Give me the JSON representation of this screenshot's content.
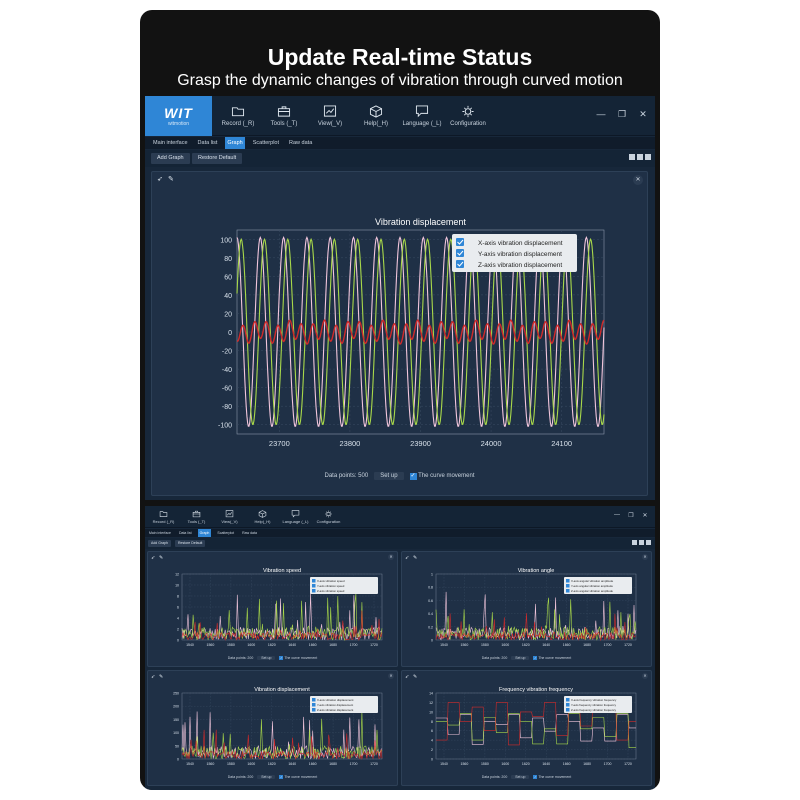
{
  "hero": {
    "title": "Update Real-time Status",
    "subtitle": "Grasp the dynamic changes of vibration through curved motion"
  },
  "app": {
    "logo": "WIT",
    "logo_sub": "witmotion",
    "menu": [
      "Record (_R)",
      "Tools (_T)",
      "View(_V)",
      "Help(_H)",
      "Language (_L)",
      "Configuration"
    ],
    "menu_icons": [
      "folder-icon",
      "toolbox-icon",
      "chart-icon",
      "cube-icon",
      "chat-icon",
      "gear-icon"
    ],
    "window_controls": [
      "—",
      "❐",
      "✕"
    ],
    "tabs": [
      "Main interface",
      "Data list",
      "Graph",
      "Scatterplot",
      "Raw data"
    ],
    "active_tab": 2,
    "toolbar": {
      "add_graph": "Add Graph",
      "restore_default": "Restore Default"
    },
    "accent": "#2f86d6",
    "background": "#17273a",
    "panel_bg": "#1f3046"
  },
  "main_chart": {
    "footer": {
      "points_label": "Data points: 500",
      "set_up": "Set up",
      "curve_movement": "The curve movement"
    }
  },
  "small_charts": {
    "footer": {
      "points_label": "Data points: 200",
      "set_up": "Set up",
      "curve_movement": "The curve movement"
    }
  },
  "chart_data": [
    {
      "type": "line",
      "title": "Vibration displacement",
      "xlim": [
        23640,
        24160
      ],
      "ylim": [
        -110,
        110
      ],
      "xticks": [
        23700,
        23800,
        23900,
        24000,
        24100
      ],
      "yticks": [
        100,
        80,
        60,
        40,
        20,
        0,
        -20,
        -40,
        -60,
        -80,
        -100
      ],
      "legend_position": "top-right",
      "series": [
        {
          "name": "X-axis vibration displacement",
          "color": "#f2c6dc",
          "amplitude": 102,
          "period": 33,
          "phase": 0
        },
        {
          "name": "Y-axis vibration displacement",
          "color": "#a8d84a",
          "amplitude": 100,
          "period": 33,
          "phase": 6
        },
        {
          "name": "Z-axis vibration displacement",
          "color": "#d02a2a",
          "amplitude": 10,
          "period": 16.5,
          "offset": 0
        }
      ]
    },
    {
      "type": "line",
      "title": "Vibration speed",
      "legend_position": "top-right",
      "yticks": [
        12,
        10,
        8,
        6,
        4,
        2,
        0
      ],
      "xticks": [
        "1540",
        "1560",
        "1580",
        "1600",
        "1620",
        "1640",
        "1660",
        "1680",
        "1700",
        "1720"
      ],
      "series": [
        {
          "name": "X-axis vibration speed",
          "color": "#f2c6dc"
        },
        {
          "name": "Y-axis vibration speed",
          "color": "#a8d84a"
        },
        {
          "name": "Z-axis vibration speed",
          "color": "#d02a2a"
        }
      ]
    },
    {
      "type": "line",
      "title": "Vibration angle",
      "legend_position": "top-right",
      "yticks": [
        1,
        0.8,
        0.6,
        0.4,
        0.2,
        0
      ],
      "xticks": [
        "1540",
        "1560",
        "1580",
        "1600",
        "1620",
        "1640",
        "1660",
        "1680",
        "1700",
        "1720"
      ],
      "series": [
        {
          "name": "X-axis angular vibration amplitude",
          "color": "#f2c6dc"
        },
        {
          "name": "Y-axis angular vibration amplitude",
          "color": "#a8d84a"
        },
        {
          "name": "Z-axis angular vibration amplitude",
          "color": "#d02a2a"
        }
      ]
    },
    {
      "type": "line",
      "title": "Vibration displacement",
      "legend_position": "top-right",
      "yticks": [
        250,
        200,
        150,
        100,
        50,
        0
      ],
      "xticks": [
        "1540",
        "1560",
        "1580",
        "1600",
        "1620",
        "1640",
        "1660",
        "1680",
        "1700",
        "1720"
      ],
      "series": [
        {
          "name": "X-axis vibration displacement",
          "color": "#f2c6dc"
        },
        {
          "name": "Y-axis vibration displacement",
          "color": "#a8d84a"
        },
        {
          "name": "Z-axis vibration displacement",
          "color": "#d02a2a"
        }
      ]
    },
    {
      "type": "line",
      "title": "Frequency vibration frequency",
      "legend_position": "top-right",
      "yticks": [
        14,
        12,
        10,
        8,
        6,
        4,
        2,
        0
      ],
      "xticks": [
        "1540",
        "1560",
        "1580",
        "1600",
        "1620",
        "1640",
        "1660",
        "1680",
        "1700",
        "1720"
      ],
      "series": [
        {
          "name": "X-axis frequency vibration frequency",
          "color": "#f2c6dc"
        },
        {
          "name": "Y-axis frequency vibration frequency",
          "color": "#a8d84a"
        },
        {
          "name": "Z-axis frequency vibration frequency",
          "color": "#d02a2a"
        }
      ]
    }
  ]
}
